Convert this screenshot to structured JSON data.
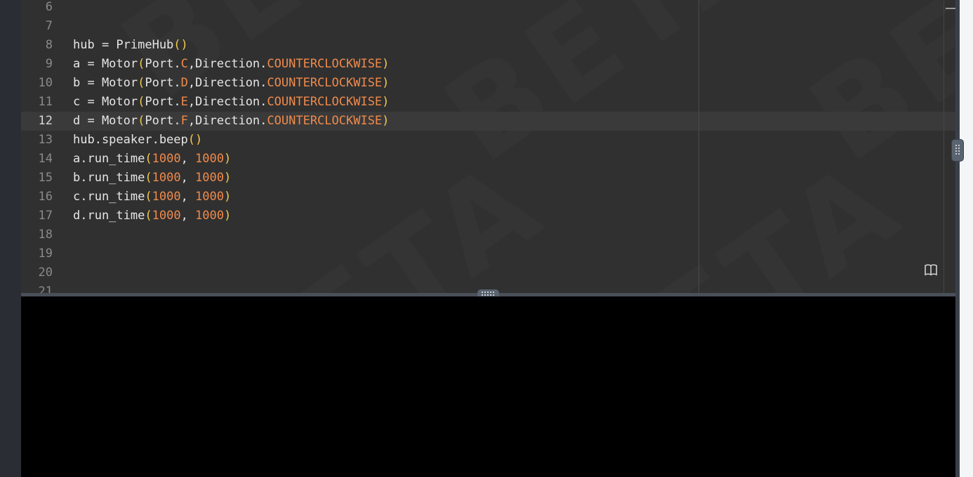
{
  "editor": {
    "watermark_text": "BETA",
    "active_line": "12",
    "lines": [
      {
        "num": "6",
        "tokens": []
      },
      {
        "num": "7",
        "tokens": []
      },
      {
        "num": "8",
        "tokens": [
          {
            "t": "hub = PrimeHub",
            "c": ""
          },
          {
            "t": "()",
            "c": "paren"
          }
        ]
      },
      {
        "num": "9",
        "tokens": [
          {
            "t": "a = Motor",
            "c": ""
          },
          {
            "t": "(",
            "c": "paren"
          },
          {
            "t": "Port.",
            "c": ""
          },
          {
            "t": "C",
            "c": "const"
          },
          {
            "t": ",Direction.",
            "c": ""
          },
          {
            "t": "COUNTERCLOCKWISE",
            "c": "const"
          },
          {
            "t": ")",
            "c": "paren"
          }
        ]
      },
      {
        "num": "10",
        "tokens": [
          {
            "t": "b = Motor",
            "c": ""
          },
          {
            "t": "(",
            "c": "paren"
          },
          {
            "t": "Port.",
            "c": ""
          },
          {
            "t": "D",
            "c": "const"
          },
          {
            "t": ",Direction.",
            "c": ""
          },
          {
            "t": "COUNTERCLOCKWISE",
            "c": "const"
          },
          {
            "t": ")",
            "c": "paren"
          }
        ]
      },
      {
        "num": "11",
        "tokens": [
          {
            "t": "c = Motor",
            "c": ""
          },
          {
            "t": "(",
            "c": "paren"
          },
          {
            "t": "Port.",
            "c": ""
          },
          {
            "t": "E",
            "c": "const"
          },
          {
            "t": ",Direction.",
            "c": ""
          },
          {
            "t": "COUNTERCLOCKWISE",
            "c": "const"
          },
          {
            "t": ")",
            "c": "paren"
          }
        ]
      },
      {
        "num": "12",
        "tokens": [
          {
            "t": "d = Motor",
            "c": ""
          },
          {
            "t": "(",
            "c": "paren"
          },
          {
            "t": "Port.",
            "c": ""
          },
          {
            "t": "F",
            "c": "const"
          },
          {
            "t": ",Direction.",
            "c": ""
          },
          {
            "t": "COUNTERCLOCKWISE",
            "c": "const"
          },
          {
            "t": ")",
            "c": "paren"
          }
        ]
      },
      {
        "num": "13",
        "tokens": [
          {
            "t": "hub.speaker.beep",
            "c": ""
          },
          {
            "t": "()",
            "c": "paren"
          }
        ]
      },
      {
        "num": "14",
        "tokens": [
          {
            "t": "a.run_time",
            "c": ""
          },
          {
            "t": "(",
            "c": "paren"
          },
          {
            "t": "1000",
            "c": "num"
          },
          {
            "t": ", ",
            "c": ""
          },
          {
            "t": "1000",
            "c": "num"
          },
          {
            "t": ")",
            "c": "paren"
          }
        ]
      },
      {
        "num": "15",
        "tokens": [
          {
            "t": "b.run_time",
            "c": ""
          },
          {
            "t": "(",
            "c": "paren"
          },
          {
            "t": "1000",
            "c": "num"
          },
          {
            "t": ", ",
            "c": ""
          },
          {
            "t": "1000",
            "c": "num"
          },
          {
            "t": ")",
            "c": "paren"
          }
        ]
      },
      {
        "num": "16",
        "tokens": [
          {
            "t": "c.run_time",
            "c": ""
          },
          {
            "t": "(",
            "c": "paren"
          },
          {
            "t": "1000",
            "c": "num"
          },
          {
            "t": ", ",
            "c": ""
          },
          {
            "t": "1000",
            "c": "num"
          },
          {
            "t": ")",
            "c": "paren"
          }
        ]
      },
      {
        "num": "17",
        "tokens": [
          {
            "t": "d.run_time",
            "c": ""
          },
          {
            "t": "(",
            "c": "paren"
          },
          {
            "t": "1000",
            "c": "num"
          },
          {
            "t": ", ",
            "c": ""
          },
          {
            "t": "1000",
            "c": "num"
          },
          {
            "t": ")",
            "c": "paren"
          }
        ]
      },
      {
        "num": "18",
        "tokens": []
      },
      {
        "num": "19",
        "tokens": []
      },
      {
        "num": "20",
        "tokens": []
      },
      {
        "num": "21",
        "tokens": []
      }
    ]
  },
  "icons": {
    "docs": "book-icon",
    "collapse": "minus-icon",
    "splitter": "drag-handle-icon",
    "side_splitter": "drag-handle-vertical-icon"
  },
  "colors": {
    "editor_bg": "#303030",
    "console_bg": "#000000",
    "paren": "#f2c94c",
    "constant": "#f08a4b",
    "text": "#e6e6e6"
  }
}
